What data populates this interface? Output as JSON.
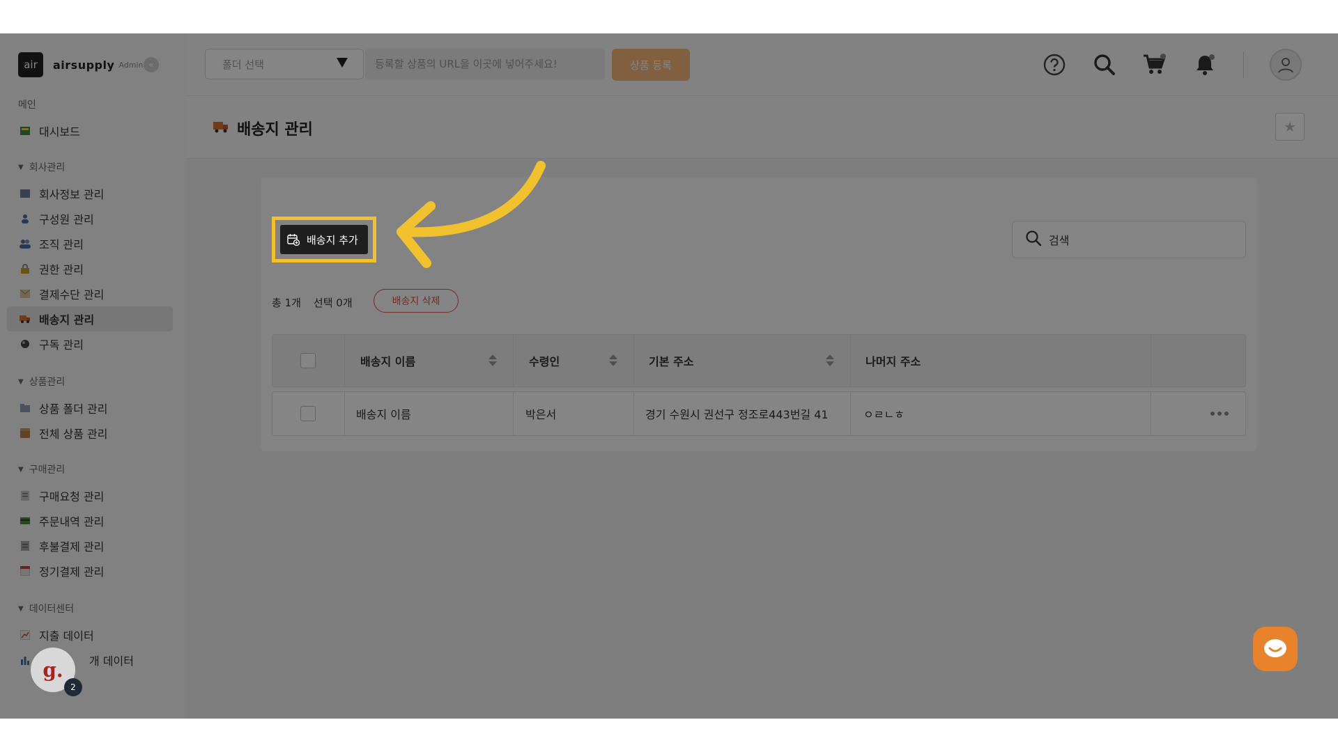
{
  "brand": {
    "logo": "air",
    "name": "airsupply",
    "badge": "Admin"
  },
  "sidebar": {
    "main_title": "메인",
    "dashboard": "대시보드",
    "groups": [
      {
        "title": "회사관리",
        "items": [
          "회사정보 관리",
          "구성원 관리",
          "조직 관리",
          "권한 관리",
          "결제수단 관리",
          "배송지 관리",
          "구독 관리"
        ]
      },
      {
        "title": "상품관리",
        "items": [
          "상품 폴더 관리",
          "전체 상품 관리"
        ]
      },
      {
        "title": "구매관리",
        "items": [
          "구매요청 관리",
          "주문내역 관리",
          "후불결제 관리",
          "정기결제 관리"
        ]
      },
      {
        "title": "데이터센터",
        "items": [
          "지출 데이터",
          "개 데이터"
        ]
      }
    ],
    "active_item": "배송지 관리"
  },
  "topbar": {
    "folder_select": "폴더 선택",
    "url_placeholder": "등록할 상품의 URL을 이곳에 넣어주세요!",
    "register_label": "상품 등록"
  },
  "page": {
    "title": "배송지 관리"
  },
  "toolbar": {
    "add_label": "배송지 추가",
    "search_placeholder": "검색",
    "total_label": "총 1개",
    "selected_label": "선택 0개",
    "delete_label": "배송지 삭제"
  },
  "table": {
    "columns": [
      "배송지 이름",
      "수령인",
      "기본 주소",
      "나머지 주소"
    ],
    "rows": [
      {
        "name": "배송지 이름",
        "recipient": "박은서",
        "address": "경기 수원시 권선구 정조로443번길 41",
        "detail": "ㅇㄹㄴㅎ"
      }
    ]
  },
  "widgets": {
    "badge_letter": "g.",
    "badge_count": "2"
  },
  "colors": {
    "accent": "#f2c22e",
    "register": "#f5b97b",
    "delete": "#d9534f",
    "chat": "#e8832c"
  }
}
